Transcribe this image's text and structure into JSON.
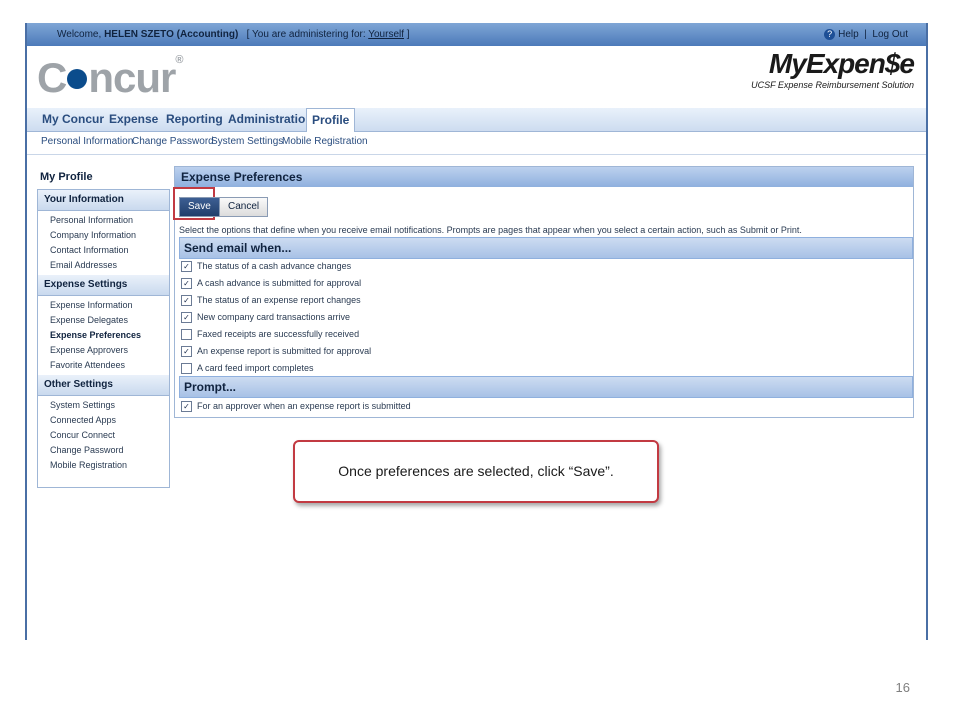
{
  "topbar": {
    "welcome_prefix": "Welcome, ",
    "user_name": "HELEN SZETO (Accounting)",
    "admin_prefix": "[ You are administering for: ",
    "admin_target": "Yourself",
    "admin_suffix": " ]",
    "help": "Help",
    "separator": "|",
    "logout": "Log Out"
  },
  "header": {
    "logo_text_c": "C",
    "logo_text_rest": "ncur",
    "logo_tm": "®",
    "brand_title": "MyExpen$e",
    "brand_subtitle": "UCSF Expense Reimbursement Solution"
  },
  "nav": {
    "tabs": [
      {
        "label": "My Concur"
      },
      {
        "label": "Expense"
      },
      {
        "label": "Reporting"
      },
      {
        "label": "Administration"
      },
      {
        "label": "Profile",
        "active": true
      }
    ],
    "subnav": [
      {
        "label": "Personal Information"
      },
      {
        "label": "Change Password"
      },
      {
        "label": "System Settings"
      },
      {
        "label": "Mobile Registration"
      }
    ]
  },
  "sidebar": {
    "title": "My Profile",
    "sections": [
      {
        "heading": "Your Information",
        "items": [
          "Personal Information",
          "Company Information",
          "Contact Information",
          "Email Addresses"
        ]
      },
      {
        "heading": "Expense Settings",
        "items": [
          "Expense Information",
          "Expense Delegates",
          "Expense Preferences",
          "Expense Approvers",
          "Favorite Attendees"
        ],
        "current": "Expense Preferences"
      },
      {
        "heading": "Other Settings",
        "items": [
          "System Settings",
          "Connected Apps",
          "Concur Connect",
          "Change Password",
          "Mobile Registration"
        ]
      }
    ]
  },
  "main": {
    "title": "Expense Preferences",
    "save_label": "Save",
    "cancel_label": "Cancel",
    "instructions": "Select the options that define when you receive email notifications. Prompts are pages that appear when you select a certain action, such as Submit or Print.",
    "email_section": "Send email when...",
    "email_options": [
      {
        "label": "The status of a cash advance changes",
        "checked": true
      },
      {
        "label": "A cash advance is submitted for approval",
        "checked": true
      },
      {
        "label": "The status of an expense report changes",
        "checked": true
      },
      {
        "label": "New company card transactions arrive",
        "checked": true
      },
      {
        "label": "Faxed receipts are successfully received",
        "checked": false
      },
      {
        "label": "An expense report is submitted for approval",
        "checked": true
      },
      {
        "label": "A card feed import completes",
        "checked": false
      }
    ],
    "prompt_section": "Prompt...",
    "prompt_options": [
      {
        "label": "For an approver when an expense report is submitted",
        "checked": true
      }
    ]
  },
  "callout": {
    "text": "Once preferences are selected, click “Save”."
  },
  "page_number": "16",
  "colors": {
    "accent": "#4c7ab9",
    "highlight": "#c23a42",
    "save_button": "#213e6b"
  },
  "icons": {
    "help": "help-circle-icon",
    "checkbox_checked": "checkbox-checked-icon",
    "checkbox_empty": "checkbox-empty-icon"
  }
}
